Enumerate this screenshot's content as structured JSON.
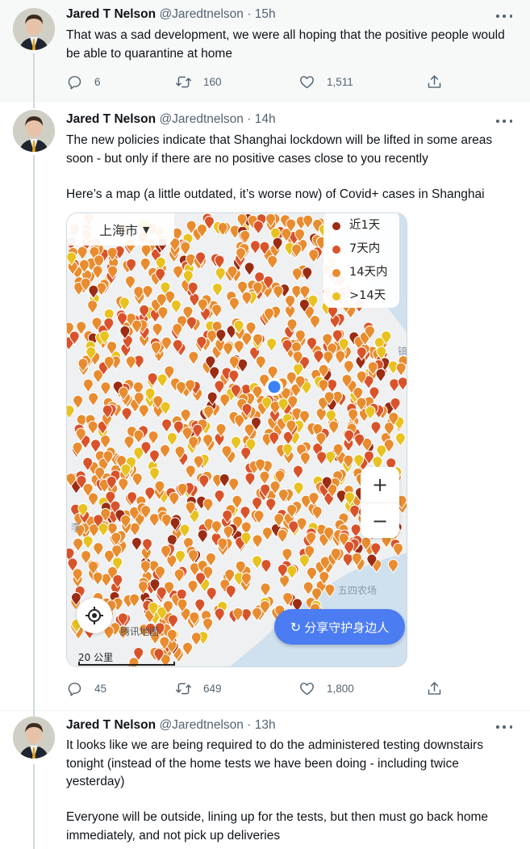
{
  "tweets": [
    {
      "name": "Jared T Nelson",
      "handle": "@Jaredtnelson",
      "time": "· 15h",
      "text": "That was a sad development, we were all hoping that the positive people would be able to quarantine at home",
      "replies": "6",
      "retweets": "160",
      "likes": "1,511"
    },
    {
      "name": "Jared T Nelson",
      "handle": "@Jaredtnelson",
      "time": "· 14h",
      "text_p1": "The new policies indicate that Shanghai lockdown will be lifted in some areas soon - but only if there are no positive cases close to you recently",
      "text_p2": "Here’s a map (a little outdated, it’s worse now) of Covid+ cases in Shanghai",
      "replies": "45",
      "retweets": "649",
      "likes": "1,800",
      "map": {
        "city": "上海市",
        "legend": [
          {
            "label": "近1天",
            "color": "#9b2c14"
          },
          {
            "label": "7天内",
            "color": "#d9532a"
          },
          {
            "label": "14天内",
            "color": "#e88c2f"
          },
          {
            "label": ">14天",
            "color": "#e8c21f"
          }
        ],
        "zoom_in": "+",
        "zoom_out": "−",
        "share_label": "分享守护身边人",
        "watermark": "腾讯地图",
        "scale": "20 公里",
        "labels": [
          "仓",
          "镇",
          "李",
          "五四农场"
        ]
      }
    },
    {
      "name": "Jared T Nelson",
      "handle": "@Jaredtnelson",
      "time": "· 13h",
      "text_p1": "It looks like we are being required to do the administered testing downstairs tonight (instead of the home tests we have been doing - including twice yesterday)",
      "text_p2": "Everyone will be outside, lining up for the tests, but then must go back home immediately, and not pick up deliveries"
    }
  ],
  "colors": {
    "text": "#0f1419",
    "secondary": "#536471",
    "thread_line": "#cfd9de",
    "share_button": "#4b7cf2",
    "location_dot": "#3b82f6"
  }
}
